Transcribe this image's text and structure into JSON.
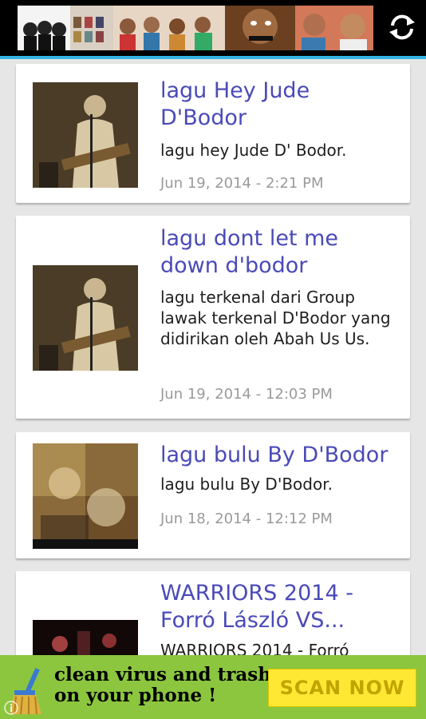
{
  "header": {
    "banner_icon": "album-collage-banner",
    "refresh_icon": "refresh-icon"
  },
  "posts": [
    {
      "title": "lagu Hey Jude D'Bodor",
      "excerpt": "lagu hey Jude D' Bodor.",
      "date": "Jun 19, 2014 - 2:21 PM"
    },
    {
      "title": "lagu dont let me down d'bodor",
      "excerpt": "lagu terkenal dari Group lawak terkenal D'Bodor yang didirikan oleh Abah Us Us.",
      "date": "Jun 19, 2014 - 12:03 PM"
    },
    {
      "title": "lagu bulu By D'Bodor",
      "excerpt": "lagu bulu By D'Bodor.",
      "date": "Jun 18, 2014 - 12:12 PM"
    },
    {
      "title": "WARRIORS 2014 - Forró László VS...",
      "excerpt": "WARRIORS 2014 - Forró"
    }
  ],
  "ad": {
    "line1": "clean virus and trash",
    "line2": "on your phone !",
    "button": "SCAN NOW",
    "colors": {
      "background": "#8cc63f",
      "button": "#ffe833",
      "button_text": "#c2a400"
    }
  },
  "colors": {
    "accent": "#33b5e5",
    "title": "#4a4ab8"
  }
}
